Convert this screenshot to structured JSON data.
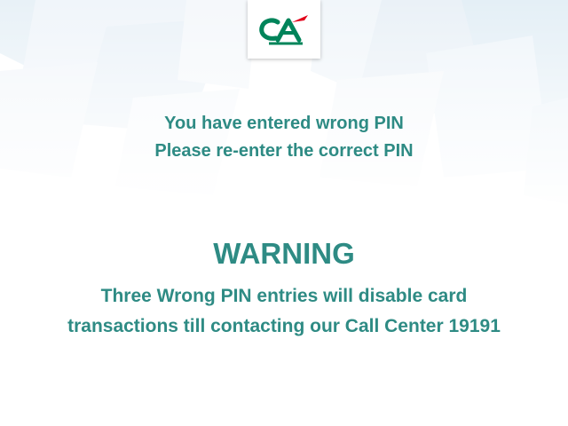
{
  "colors": {
    "text": "#2e8b84",
    "logo_green": "#00845a",
    "logo_red": "#e2001a",
    "background": "#ffffff"
  },
  "logo": {
    "icon": "credit-agricole-logo-icon",
    "text": "CA"
  },
  "message": {
    "line1": "You have entered wrong PIN",
    "line2": "Please re-enter the correct PIN"
  },
  "warning": {
    "title": "WARNING",
    "line1": "Three Wrong PIN entries will disable card",
    "line2": "transactions till contacting our Call Center 19191"
  }
}
